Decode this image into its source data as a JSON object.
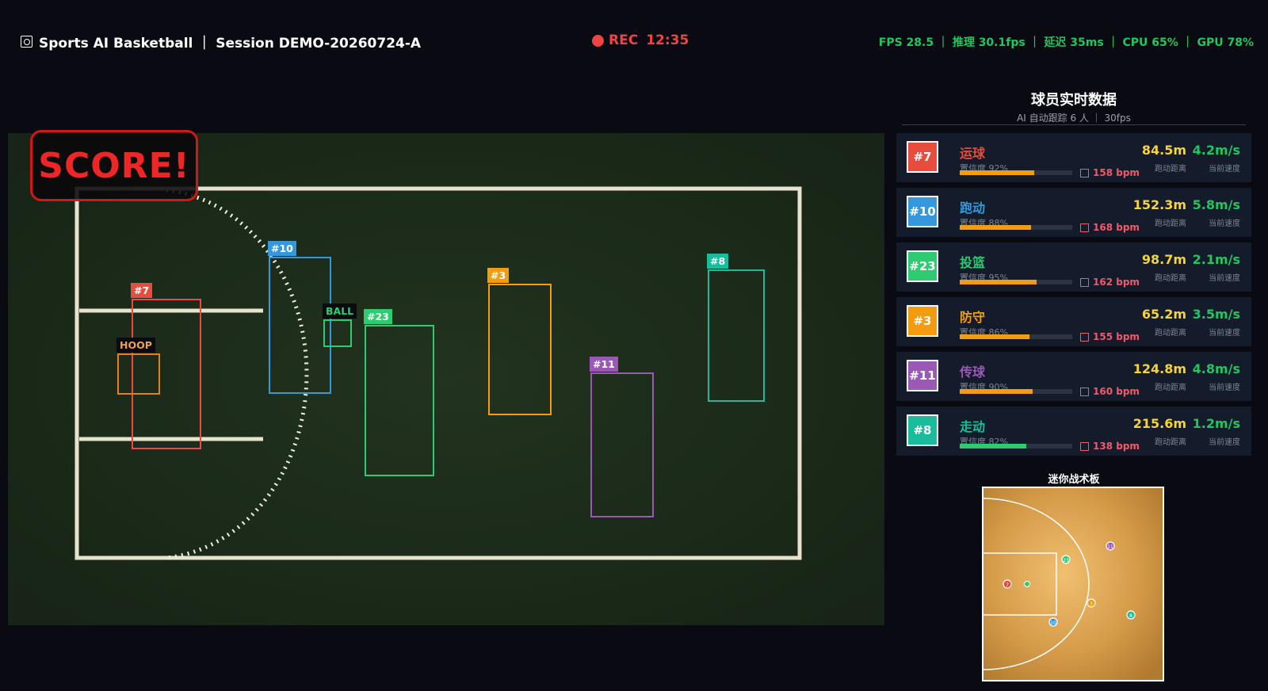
{
  "header": {
    "title": "Sports AI Basketball ｜ Session DEMO-20260724-A",
    "rec_label": "REC",
    "rec_time": "12:35",
    "stats": "FPS 28.5 ｜ 推理 30.1fps ｜ 延迟 35ms ｜ CPU 65% ｜ GPU 78%"
  },
  "overlay": {
    "score_text": "SCORE!",
    "hoop_label": "HOOP",
    "ball_label": "BALL",
    "tags": [
      "#7",
      "#10",
      "#23",
      "#3",
      "#11",
      "#8"
    ]
  },
  "panel": {
    "title": "球员实时数据",
    "subtitle": "AI 自动跟踪 6 人 ｜ 30fps",
    "distance_label": "跑动距离",
    "speed_label": "当前速度",
    "players": [
      {
        "num": "#7",
        "action": "运球",
        "confidence": "置信度 92%",
        "conf_value": 0.92,
        "bpm": "158 bpm",
        "distance": "84.5m",
        "speed": "4.2m/s",
        "color": "#e74c3c",
        "bar_color": "#f39c12"
      },
      {
        "num": "#10",
        "action": "跑动",
        "confidence": "置信度 88%",
        "conf_value": 0.88,
        "bpm": "168 bpm",
        "distance": "152.3m",
        "speed": "5.8m/s",
        "color": "#3498db",
        "bar_color": "#f39c12"
      },
      {
        "num": "#23",
        "action": "投篮",
        "confidence": "置信度 95%",
        "conf_value": 0.95,
        "bpm": "162 bpm",
        "distance": "98.7m",
        "speed": "2.1m/s",
        "color": "#2ecc71",
        "bar_color": "#f39c12"
      },
      {
        "num": "#3",
        "action": "防守",
        "confidence": "置信度 86%",
        "conf_value": 0.86,
        "bpm": "155 bpm",
        "distance": "65.2m",
        "speed": "3.5m/s",
        "color": "#f39c12",
        "bar_color": "#f39c12"
      },
      {
        "num": "#11",
        "action": "传球",
        "confidence": "置信度 90%",
        "conf_value": 0.9,
        "bpm": "160 bpm",
        "distance": "124.8m",
        "speed": "4.8m/s",
        "color": "#9b59b6",
        "bar_color": "#f39c12"
      },
      {
        "num": "#8",
        "action": "走动",
        "confidence": "置信度 82%",
        "conf_value": 0.82,
        "bpm": "138 bpm",
        "distance": "215.6m",
        "speed": "1.2m/s",
        "color": "#1abc9c",
        "bar_color": "#2ecc71"
      }
    ]
  },
  "minimap": {
    "title": "迷你战术板",
    "markers": [
      "7",
      "10",
      "23",
      "3",
      "11",
      "8"
    ]
  }
}
